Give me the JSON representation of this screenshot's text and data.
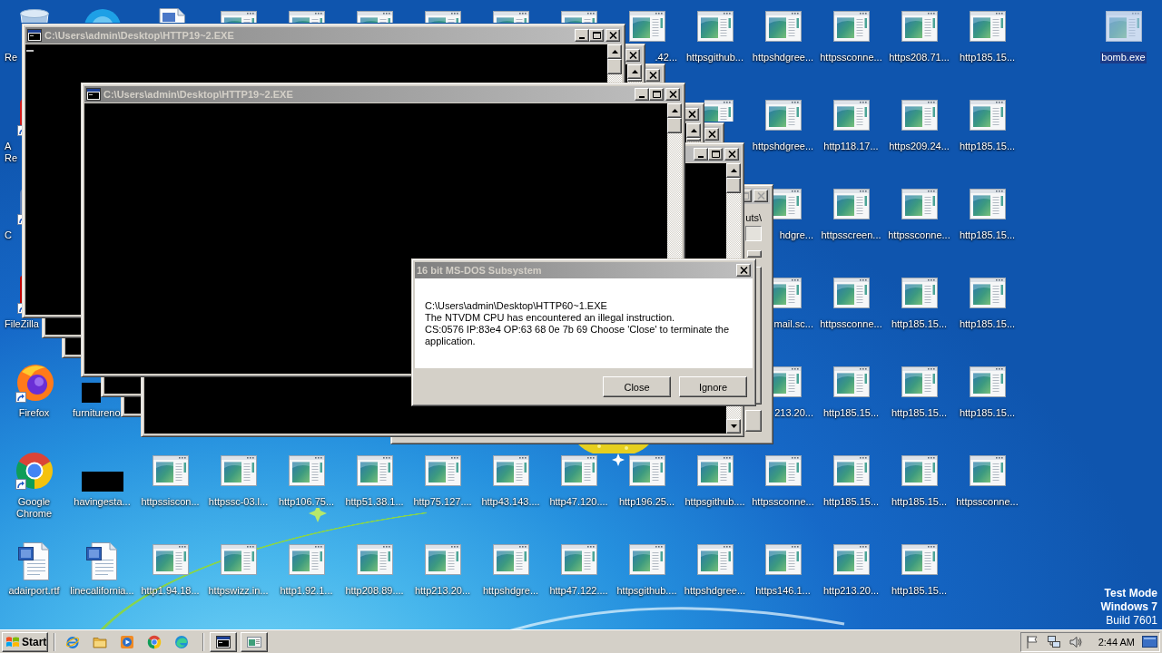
{
  "desktop": {
    "icons": [
      {
        "kind": "recycle-bin",
        "label_start": "Re",
        "selected": false
      },
      {
        "kind": "reader",
        "label_start": "A\nRe",
        "selected": false
      },
      {
        "kind": "shortcut",
        "label_start": "C",
        "selected": false
      },
      {
        "kind": "filezilla",
        "label_start": "FileZilla",
        "selected": false
      },
      {
        "kind": "firefox",
        "label": "Firefox",
        "selected": false
      },
      {
        "kind": "chrome",
        "label": "Google Chrome",
        "selected": false
      },
      {
        "kind": "word",
        "label": "adairport.rtf",
        "selected": false
      },
      {
        "kind": "app",
        "selected": false
      },
      {
        "kind": "thumbnail",
        "label_start": "furnitureno",
        "selected": false
      },
      {
        "kind": "thumbnail",
        "label": "havingesta...",
        "selected": false
      },
      {
        "kind": "word",
        "label": "linecalifornia...",
        "selected": false
      },
      {
        "kind": "document",
        "selected": false
      },
      {
        "kind": "webpage",
        "label": "httpssiscon...",
        "selected": false
      },
      {
        "kind": "webpage",
        "label": "http1.94.18...",
        "selected": false
      },
      {
        "kind": "webpage",
        "selected": false
      },
      {
        "kind": "webpage",
        "label": "httpssc-03.l...",
        "selected": false
      },
      {
        "kind": "webpage",
        "label": "httpswizz.in...",
        "selected": false
      },
      {
        "kind": "webpage",
        "selected": false
      },
      {
        "kind": "webpage",
        "label": "http106.75...",
        "selected": false
      },
      {
        "kind": "webpage",
        "label": "http1.92.1...",
        "selected": false
      },
      {
        "kind": "webpage",
        "selected": false
      },
      {
        "kind": "webpage",
        "label": "http51.38.1...",
        "selected": false
      },
      {
        "kind": "webpage",
        "label": "http208.89....",
        "selected": false
      },
      {
        "kind": "webpage",
        "selected": false
      },
      {
        "kind": "webpage",
        "label": "http75.127....",
        "selected": false
      },
      {
        "kind": "webpage",
        "label": "http213.20...",
        "selected": false
      },
      {
        "kind": "webpage",
        "selected": false
      },
      {
        "kind": "webpage",
        "label": "http43.143....",
        "selected": false
      },
      {
        "kind": "webpage",
        "label": "httpshdgre...",
        "selected": false
      },
      {
        "kind": "webpage",
        "selected": false
      },
      {
        "kind": "webpage",
        "label": "http47.120....",
        "selected": false
      },
      {
        "kind": "webpage",
        "label": "http47.122....",
        "selected": false
      },
      {
        "kind": "webpage",
        "label_end": ".42...",
        "selected": false
      },
      {
        "kind": "webpage",
        "label": "http196.25...",
        "selected": false
      },
      {
        "kind": "webpage",
        "label": "httpsgithub....",
        "selected": false
      },
      {
        "kind": "webpage",
        "label": "httpsgithub...",
        "selected": false
      },
      {
        "kind": "webpage",
        "selected": false
      },
      {
        "kind": "webpage",
        "label": "httpsgithub....",
        "selected": false
      },
      {
        "kind": "webpage",
        "label": "httpshdgree...",
        "selected": false
      },
      {
        "kind": "webpage",
        "label": "httpshdgree...",
        "selected": false
      },
      {
        "kind": "webpage",
        "label": "httpshdgree...",
        "selected": false
      },
      {
        "kind": "webpage",
        "label_end": "hdgre...",
        "selected": false
      },
      {
        "kind": "webpage",
        "label_end": "mail.sc...",
        "selected": false
      },
      {
        "kind": "webpage",
        "label_end": "213.20...",
        "selected": false
      },
      {
        "kind": "webpage",
        "label": "httpssconne...",
        "selected": false
      },
      {
        "kind": "webpage",
        "label": "https146.1...",
        "selected": false
      },
      {
        "kind": "webpage",
        "label": "httpssconne...",
        "selected": false
      },
      {
        "kind": "webpage",
        "label": "http118.17...",
        "selected": false
      },
      {
        "kind": "webpage",
        "label": "httpsscreen...",
        "selected": false
      },
      {
        "kind": "webpage",
        "label": "httpssconne...",
        "selected": false
      },
      {
        "kind": "webpage",
        "label": "http185.15...",
        "selected": false
      },
      {
        "kind": "webpage",
        "label": "http185.15...",
        "selected": false
      },
      {
        "kind": "webpage",
        "label": "http213.20...",
        "selected": false
      },
      {
        "kind": "webpage",
        "label": "https208.71...",
        "selected": false
      },
      {
        "kind": "webpage",
        "label": "https209.24...",
        "selected": false
      },
      {
        "kind": "webpage",
        "label": "httpssconne...",
        "selected": false
      },
      {
        "kind": "webpage",
        "label": "http185.15...",
        "selected": false
      },
      {
        "kind": "webpage",
        "label": "http185.15...",
        "selected": false
      },
      {
        "kind": "webpage",
        "label": "http185.15...",
        "selected": false
      },
      {
        "kind": "webpage",
        "label": "http185.15...",
        "selected": false
      },
      {
        "kind": "webpage",
        "label": "http185.15...",
        "selected": false
      },
      {
        "kind": "webpage",
        "label": "http185.15...",
        "selected": false
      },
      {
        "kind": "webpage",
        "label": "http185.15...",
        "selected": false
      },
      {
        "kind": "webpage",
        "label": "http185.15...",
        "selected": false
      },
      {
        "kind": "webpage",
        "label": "http185.15...",
        "selected": false
      },
      {
        "kind": "webpage",
        "label": "httpssconne...",
        "selected": false
      },
      {
        "kind": "webpage",
        "label": "bomb.exe",
        "selected": true
      }
    ]
  },
  "windows": [
    {
      "kind": "dialog",
      "text": "uts\\"
    },
    {
      "kind": "console",
      "cursor": false
    },
    {
      "kind": "console",
      "cursor": false
    },
    {
      "kind": "console",
      "title": "C:\\Users\\admin\\Desktop\\HTTP19~2.EXE",
      "cursor": true
    },
    {
      "kind": "console",
      "cursor": false
    },
    {
      "kind": "console",
      "cursor": false
    },
    {
      "kind": "console",
      "cursor": false
    },
    {
      "kind": "console",
      "title": "C:\\Users\\admin\\Desktop\\HTTP19~2.EXE",
      "cursor": false
    }
  ],
  "error_dialog": {
    "title": "16 bit MS-DOS Subsystem",
    "message": [
      "C:\\Users\\admin\\Desktop\\HTTP60~1.EXE",
      "The NTVDM CPU has encountered an illegal instruction.",
      "CS:0576 IP:83e4 OP:63 68 0e 7b 69 Choose 'Close' to terminate the application."
    ],
    "buttons": [
      "Close",
      "Ignore"
    ]
  },
  "system_notice": [
    "Test Mode",
    "Windows 7",
    "Build 7601"
  ],
  "taskbar": {
    "start": "Start",
    "clock": "2:44 AM"
  }
}
